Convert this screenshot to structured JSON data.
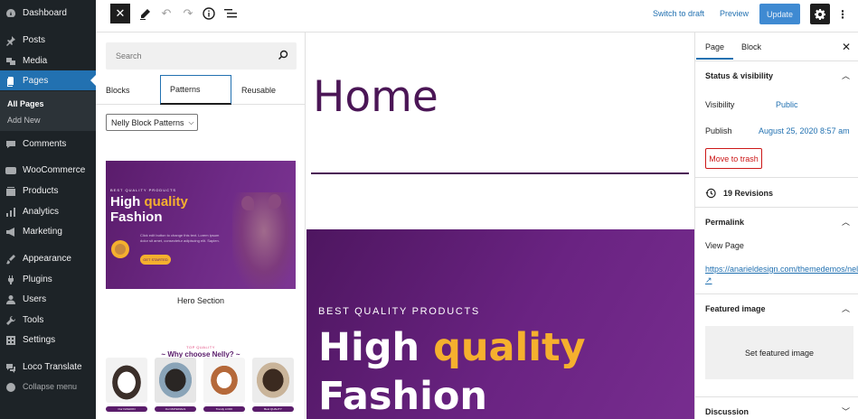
{
  "admin_menu": {
    "items": [
      {
        "label": "Dashboard",
        "icon": "dashboard-icon"
      },
      {
        "label": "Posts",
        "icon": "pin-icon"
      },
      {
        "label": "Media",
        "icon": "media-icon"
      },
      {
        "label": "Pages",
        "icon": "pages-icon"
      },
      {
        "label": "Comments",
        "icon": "comments-icon"
      },
      {
        "label": "WooCommerce",
        "icon": "woo-icon"
      },
      {
        "label": "Products",
        "icon": "products-icon"
      },
      {
        "label": "Analytics",
        "icon": "analytics-icon"
      },
      {
        "label": "Marketing",
        "icon": "marketing-icon"
      },
      {
        "label": "Appearance",
        "icon": "brush-icon"
      },
      {
        "label": "Plugins",
        "icon": "plugin-icon"
      },
      {
        "label": "Users",
        "icon": "users-icon"
      },
      {
        "label": "Tools",
        "icon": "wrench-icon"
      },
      {
        "label": "Settings",
        "icon": "settings-icon"
      },
      {
        "label": "Loco Translate",
        "icon": "translate-icon"
      },
      {
        "label": "Collapse menu",
        "icon": "collapse-icon"
      }
    ],
    "submenu": [
      "All Pages",
      "Add New"
    ],
    "active_color": "#2271b1"
  },
  "toolbar": {
    "switch_draft": "Switch to draft",
    "preview": "Preview",
    "update": "Update"
  },
  "inserter": {
    "search_placeholder": "Search",
    "tabs": [
      "Blocks",
      "Patterns",
      "Reusable"
    ],
    "category": "Nelly Block Patterns",
    "pattern1": {
      "eyebrow": "BEST QUALITY PRODUCTS",
      "line1a": "High ",
      "line1b": "quality",
      "line2": "Fashion",
      "desc": "Click edit button to change this text. Lorem ipsum dolor sit amet, consectetur adipiscing elit. Sapien.",
      "button": "GET STARTED",
      "label": "Hero Section"
    },
    "pattern2": {
      "eyebrow": "TOP QUALITY",
      "heading": "~ Why choose Nelly? ~",
      "pills": [
        "Our FASHION",
        "Our MATERIALS",
        "Trendy LOOK",
        "Best QUALITY"
      ]
    }
  },
  "canvas": {
    "title": "Home",
    "hero": {
      "eyebrow": "BEST QUALITY PRODUCTS",
      "line1a": "High ",
      "line1b": "quality",
      "line2": "Fashion"
    },
    "brand_color": "#4b1656",
    "accent_color": "#f5b02e"
  },
  "settings": {
    "tabs": [
      "Page",
      "Block"
    ],
    "status_title": "Status & visibility",
    "visibility_label": "Visibility",
    "visibility_value": "Public",
    "publish_label": "Publish",
    "publish_value": "August 25, 2020 8:57 am",
    "trash": "Move to trash",
    "revisions": "19 Revisions",
    "permalink_title": "Permalink",
    "view_page": "View Page",
    "permalink_url": "https://anarieldesign.com/themedemos/nelly/",
    "featured_title": "Featured image",
    "set_featured": "Set featured image",
    "discussion_title": "Discussion"
  }
}
